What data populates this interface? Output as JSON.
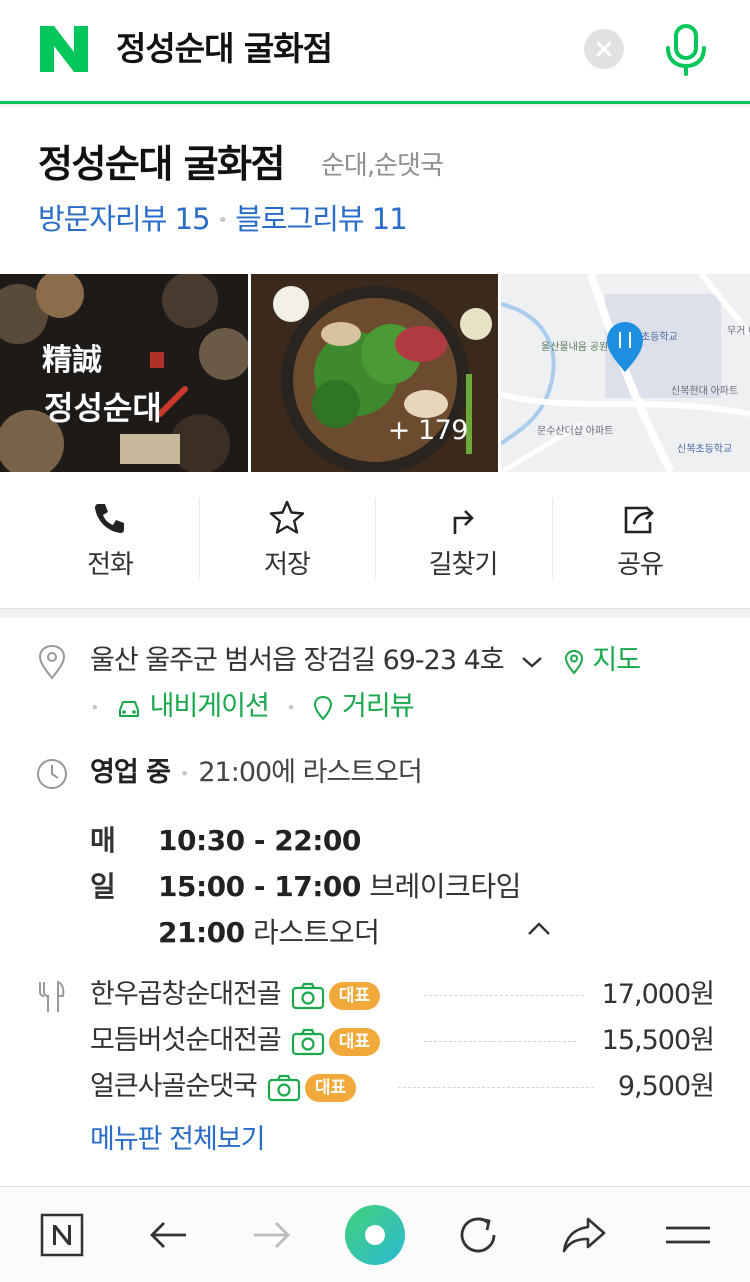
{
  "search": {
    "query": "정성순대 굴화점"
  },
  "place": {
    "name": "정성순대 굴화점",
    "category": "순대,순댓국",
    "visitor_review_label": "방문자리뷰",
    "visitor_review_count": "15",
    "blog_review_label": "블로그리뷰",
    "blog_review_count": "11",
    "photo_count": "+ 179",
    "photo1_logo_text": "정성순대",
    "map_labels": [
      "울산물내음 공원",
      "신복현대 아파트",
      "문수산더샵 아파트",
      "신복초등학교",
      "초등학교",
      "무거 아파"
    ]
  },
  "actions": [
    {
      "label": "전화",
      "icon": "phone-icon"
    },
    {
      "label": "저장",
      "icon": "star-icon"
    },
    {
      "label": "길찾기",
      "icon": "directions-icon"
    },
    {
      "label": "공유",
      "icon": "share-icon"
    }
  ],
  "address": {
    "text": "울산 울주군 범서읍 장검길 69-23 4호",
    "map_link": "지도",
    "navigation_link": "내비게이션",
    "streetview_link": "거리뷰"
  },
  "hours": {
    "status": "영업 중",
    "last_order_note": "21:00에 라스트오더",
    "day_label": "매일",
    "open_range": "10:30 - 22:00",
    "break_time_range": "15:00 - 17:00",
    "break_time_label": "브레이크타임",
    "last_order_time": "21:00",
    "last_order_label": "라스트오더"
  },
  "menu": {
    "items": [
      {
        "name": "한우곱창순대전골",
        "badge": "대표",
        "price": "17,000원"
      },
      {
        "name": "모듬버섯순대전골",
        "badge": "대표",
        "price": "15,500원"
      },
      {
        "name": "얼큰사골순댓국",
        "badge": "대표",
        "price": "9,500원"
      }
    ],
    "view_all": "메뉴판 전체보기"
  },
  "colors": {
    "naver_green": "#03c75a",
    "link_blue": "#2a6dc9",
    "link_green": "#19a84c",
    "badge_orange": "#f2a93b"
  }
}
